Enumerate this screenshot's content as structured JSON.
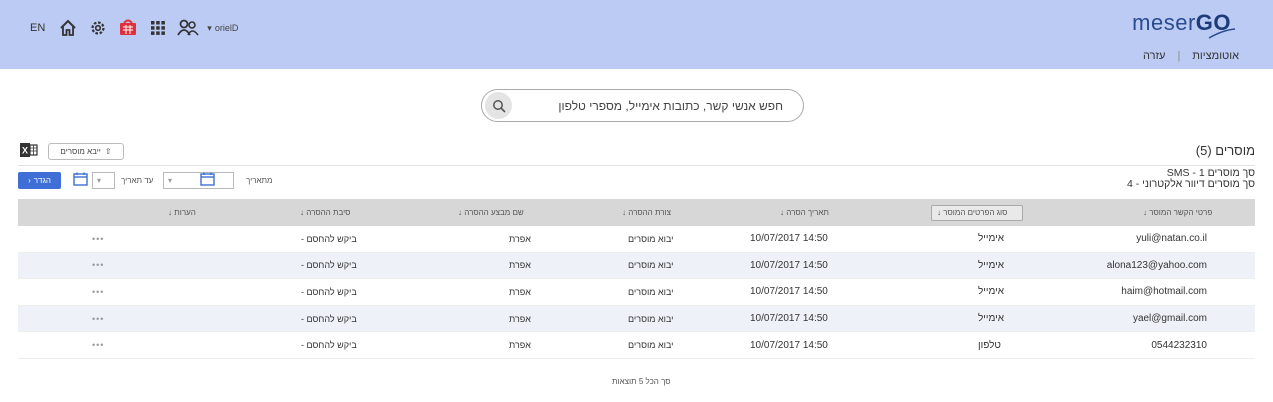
{
  "header": {
    "lang": "EN",
    "user": "orielD",
    "logo_light": "meser",
    "logo_bold": "GO",
    "nav": [
      "אוטומציות",
      "עזרה"
    ]
  },
  "search": {
    "placeholder": "חפש אנשי קשר, כתובות אימייל, מספרי טלפון"
  },
  "page": {
    "title": "מוסרים (5)",
    "import_label": "ייבא מוסרים",
    "summary_sms": "סך מוסרים SMS - 1",
    "summary_email": "סך מוסרים דיוור אלקטרוני - 4"
  },
  "filters": {
    "from_label": "מתאריך",
    "to_label": "עד תאריך",
    "back_label": "הגדר"
  },
  "table": {
    "columns": [
      "פרטי הקשר המוסר",
      "סוג הפרטים המוסר",
      "תאריך הסרה",
      "צורת ההסרה",
      "שם מבצע ההסרה",
      "סיבת ההסרה",
      "הערות"
    ],
    "rows": [
      {
        "contact": "yuli@natan.co.il",
        "type": "אימייל",
        "date": "10/07/2017 14:50",
        "method": "יבוא מוסרים",
        "by": "אפרת",
        "reason": "ביקש להחסם -",
        "notes": "•••"
      },
      {
        "contact": "alona123@yahoo.com",
        "type": "אימייל",
        "date": "10/07/2017 14:50",
        "method": "יבוא מוסרים",
        "by": "אפרת",
        "reason": "ביקש להחסם -",
        "notes": "•••"
      },
      {
        "contact": "haim@hotmail.com",
        "type": "אימייל",
        "date": "10/07/2017 14:50",
        "method": "יבוא מוסרים",
        "by": "אפרת",
        "reason": "ביקש להחסם -",
        "notes": "•••"
      },
      {
        "contact": "yael@gmail.com",
        "type": "אימייל",
        "date": "10/07/2017 14:50",
        "method": "יבוא מוסרים",
        "by": "אפרת",
        "reason": "ביקש להחסם -",
        "notes": "•••"
      },
      {
        "contact": "0544232310",
        "type": "טלפון",
        "date": "10/07/2017 14:50",
        "method": "יבוא מוסרים",
        "by": "אפרת",
        "reason": "ביקש להחסם -",
        "notes": "•••"
      }
    ],
    "footer": "סך הכל 5 תוצאות"
  },
  "colors": {
    "topbar": "#bccbf3",
    "accent": "#3e6ed6",
    "cart": "#e0303b",
    "row_alt": "#eef2f8"
  }
}
